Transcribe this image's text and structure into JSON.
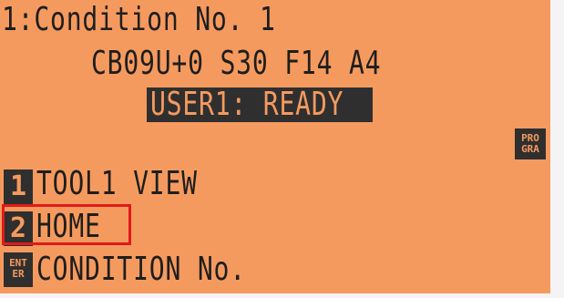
{
  "screen": {
    "title": "1:Condition No. 1",
    "params": "CB09U+0 S30 F14 A4",
    "status": "USER1: READY",
    "prog_badge": "PRO\nGRA"
  },
  "menu": [
    {
      "key": "1",
      "label": "TOOL1 VIEW"
    },
    {
      "key": "2",
      "label": "HOME"
    }
  ],
  "enter_item": {
    "key": "ENT\nER",
    "label": "CONDITION No."
  },
  "colors": {
    "screen_bg": "#f59a5e",
    "text": "#1e1e1e",
    "inverse_bg": "#2f2f2f",
    "highlight": "#e11a1a"
  }
}
